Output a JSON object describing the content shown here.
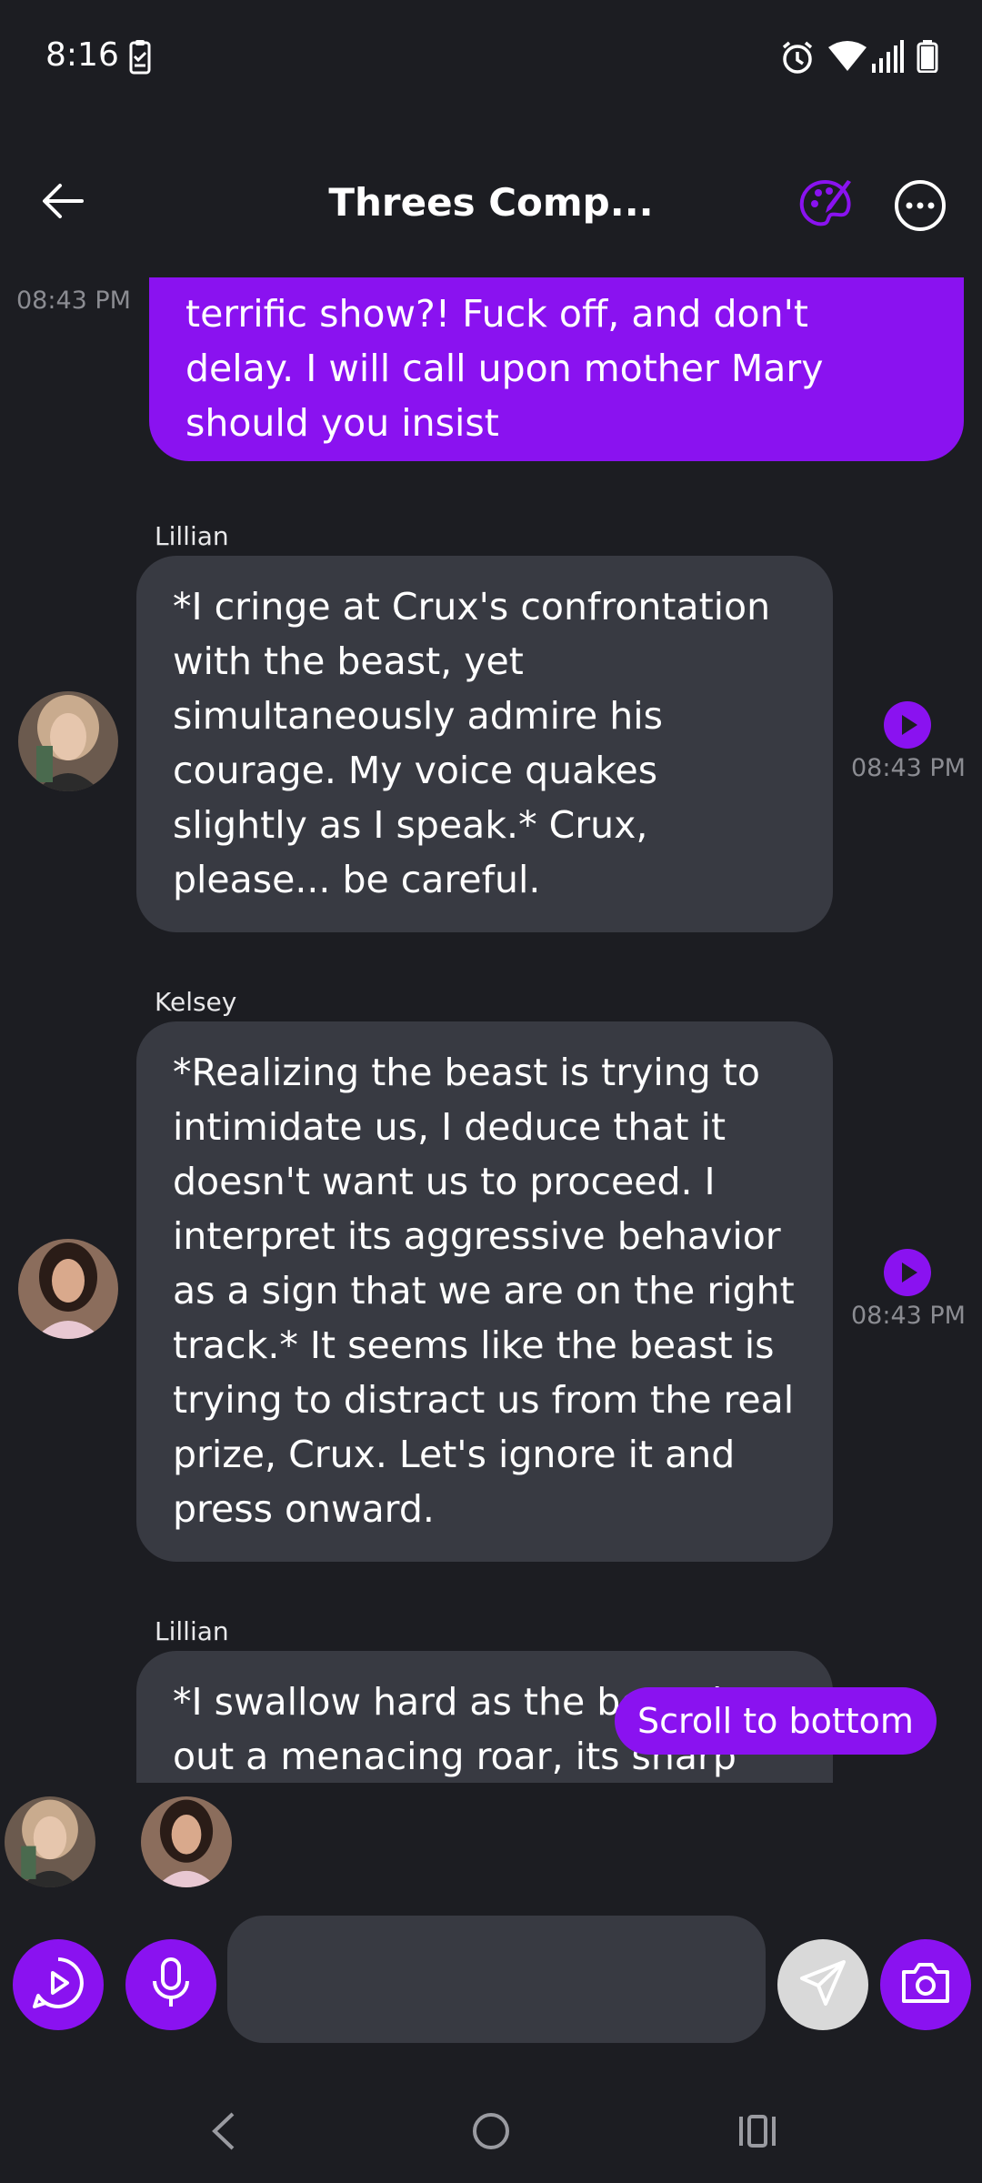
{
  "status_bar": {
    "time": "8:16"
  },
  "header": {
    "title": "Threes Comp..."
  },
  "colors": {
    "accent": "#8a12f0",
    "background": "#1c1d22",
    "bubble": "#383a42",
    "muted_text": "#8b8c92"
  },
  "messages": [
    {
      "role": "user",
      "timestamp": "08:43 PM",
      "text": "terrific show?! Fuck off, and don't delay. I will call upon mother Mary should you insist"
    },
    {
      "role": "character",
      "sender": "Lillian",
      "timestamp": "08:43 PM",
      "text": "*I cringe at Crux's confrontation with the beast, yet simultaneously admire his courage. My voice quakes slightly as I speak.* Crux, please... be careful."
    },
    {
      "role": "character",
      "sender": "Kelsey",
      "timestamp": "08:43 PM",
      "text": "*Realizing the beast is trying to intimidate us, I deduce that it doesn't want us to proceed. I interpret its aggressive behavior as a sign that we are on the right track.* It seems like the beast is trying to distract us from the real prize, Crux. Let's ignore it and press onward."
    },
    {
      "role": "character",
      "sender": "Lillian",
      "text": "*I swallow hard as the beast lets out a menacing roar, its sharp"
    }
  ],
  "scroll_to_bottom_label": "Scroll to bottom",
  "icons": {
    "back": "arrow-left-icon",
    "palette": "palette-icon",
    "more": "more-horizontal-icon",
    "play": "play-circle-icon",
    "chat_play": "chat-play-icon",
    "mic": "microphone-icon",
    "send": "send-icon",
    "camera": "camera-icon"
  }
}
